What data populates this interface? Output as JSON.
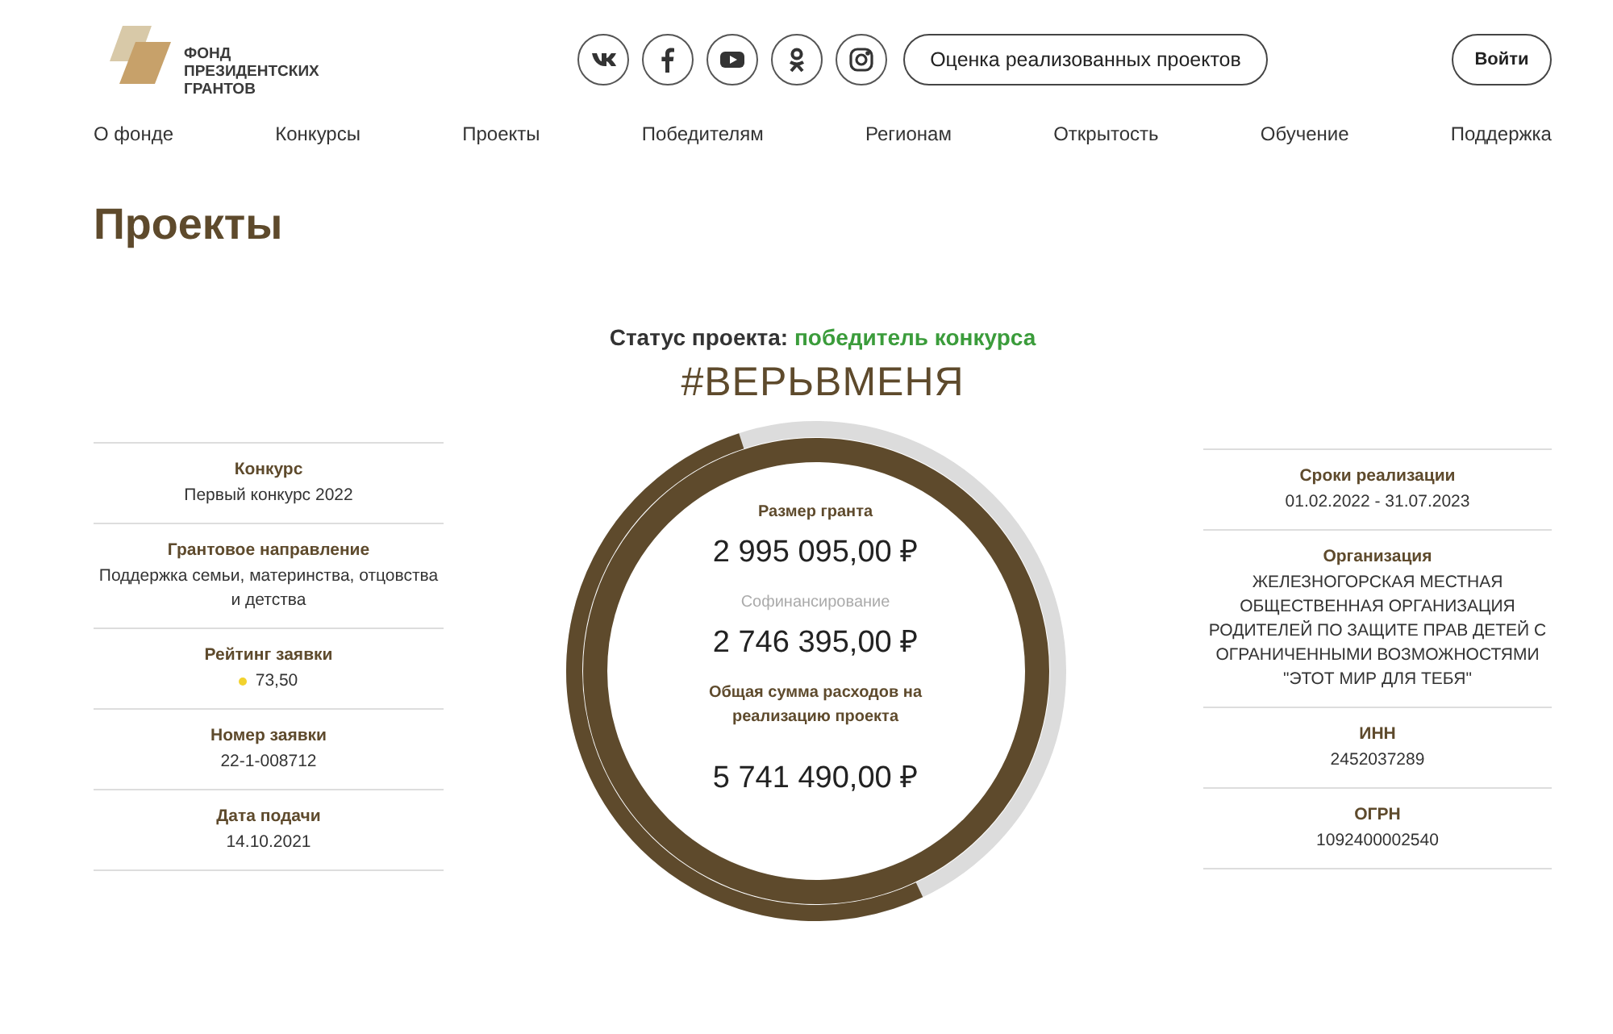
{
  "logo": {
    "lines": [
      "ФОНД",
      "ПРЕЗИДЕНТСКИХ",
      "ГРАНТОВ"
    ]
  },
  "social": [
    {
      "kind": "vk"
    },
    {
      "kind": "facebook"
    },
    {
      "kind": "youtube"
    },
    {
      "kind": "ok"
    },
    {
      "kind": "instagram"
    }
  ],
  "evaluation_button": "Оценка реализованных проектов",
  "login_button": "Войти",
  "nav": [
    {
      "label": "О фонде"
    },
    {
      "label": "Конкурсы"
    },
    {
      "label": "Проекты"
    },
    {
      "label": "Победителям"
    },
    {
      "label": "Регионам"
    },
    {
      "label": "Открытость"
    },
    {
      "label": "Обучение"
    },
    {
      "label": "Поддержка"
    }
  ],
  "page_title": "Проекты",
  "status": {
    "label": "Статус проекта:",
    "value": "победитель конкурса"
  },
  "project_name": "#ВЕРЬВМЕНЯ",
  "left_info": [
    {
      "label": "Конкурс",
      "value": "Первый конкурс 2022"
    },
    {
      "label": "Грантовое направление",
      "value": "Поддержка семьи, материнства, отцовства и детства"
    },
    {
      "label": "Рейтинг заявки",
      "value": "73,50",
      "kind": "rating"
    },
    {
      "label": "Номер заявки",
      "value": "22-1-008712"
    },
    {
      "label": "Дата подачи",
      "value": "14.10.2021"
    }
  ],
  "finance": {
    "level": 0.52,
    "items": [
      {
        "label": "Размер гранта",
        "value": "2 995 095,00 ₽",
        "kind": "grant"
      },
      {
        "label": "Софинансирование",
        "value": "2 746 395,00 ₽",
        "kind": "cofinancing"
      },
      {
        "label": "Общая сумма расходов на реализацию проекта",
        "value": "5 741 490,00 ₽",
        "kind": "total"
      }
    ]
  },
  "right_info": [
    {
      "label": "Сроки реализации",
      "value": "01.02.2022 - 31.07.2023"
    },
    {
      "label": "Организация",
      "value": "ЖЕЛЕЗНОГОРСКАЯ МЕСТНАЯ ОБЩЕСТВЕННАЯ ОРГАНИЗАЦИЯ РОДИТЕЛЕЙ ПО ЗАЩИТЕ ПРАВ ДЕТЕЙ С ОГРАНИЧЕННЫМИ ВОЗМОЖНОСТЯМИ \"ЭТОТ МИР ДЛЯ ТЕБЯ\""
    },
    {
      "label": "ИНН",
      "value": "2452037289"
    },
    {
      "label": "ОГРН",
      "value": "1092400002540"
    }
  ]
}
